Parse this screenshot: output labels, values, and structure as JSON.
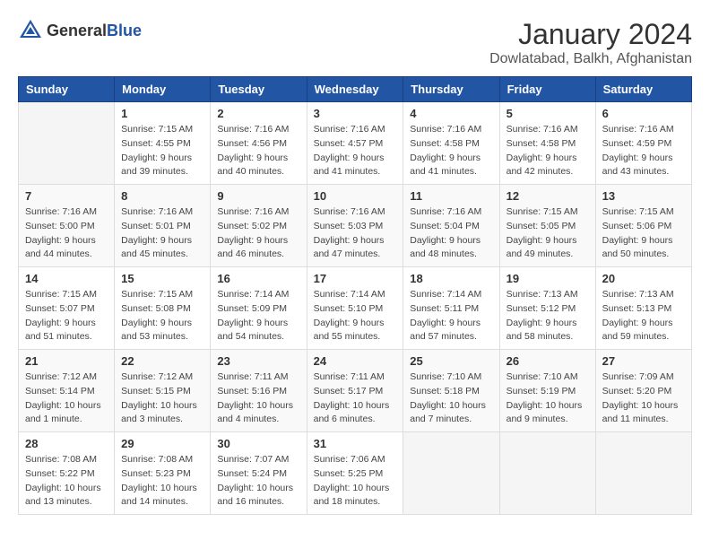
{
  "header": {
    "logo_general": "General",
    "logo_blue": "Blue",
    "title": "January 2024",
    "location": "Dowlatabad, Balkh, Afghanistan"
  },
  "weekdays": [
    "Sunday",
    "Monday",
    "Tuesday",
    "Wednesday",
    "Thursday",
    "Friday",
    "Saturday"
  ],
  "weeks": [
    [
      {
        "day": "",
        "info": ""
      },
      {
        "day": "1",
        "info": "Sunrise: 7:15 AM\nSunset: 4:55 PM\nDaylight: 9 hours\nand 39 minutes."
      },
      {
        "day": "2",
        "info": "Sunrise: 7:16 AM\nSunset: 4:56 PM\nDaylight: 9 hours\nand 40 minutes."
      },
      {
        "day": "3",
        "info": "Sunrise: 7:16 AM\nSunset: 4:57 PM\nDaylight: 9 hours\nand 41 minutes."
      },
      {
        "day": "4",
        "info": "Sunrise: 7:16 AM\nSunset: 4:58 PM\nDaylight: 9 hours\nand 41 minutes."
      },
      {
        "day": "5",
        "info": "Sunrise: 7:16 AM\nSunset: 4:58 PM\nDaylight: 9 hours\nand 42 minutes."
      },
      {
        "day": "6",
        "info": "Sunrise: 7:16 AM\nSunset: 4:59 PM\nDaylight: 9 hours\nand 43 minutes."
      }
    ],
    [
      {
        "day": "7",
        "info": "Sunrise: 7:16 AM\nSunset: 5:00 PM\nDaylight: 9 hours\nand 44 minutes."
      },
      {
        "day": "8",
        "info": "Sunrise: 7:16 AM\nSunset: 5:01 PM\nDaylight: 9 hours\nand 45 minutes."
      },
      {
        "day": "9",
        "info": "Sunrise: 7:16 AM\nSunset: 5:02 PM\nDaylight: 9 hours\nand 46 minutes."
      },
      {
        "day": "10",
        "info": "Sunrise: 7:16 AM\nSunset: 5:03 PM\nDaylight: 9 hours\nand 47 minutes."
      },
      {
        "day": "11",
        "info": "Sunrise: 7:16 AM\nSunset: 5:04 PM\nDaylight: 9 hours\nand 48 minutes."
      },
      {
        "day": "12",
        "info": "Sunrise: 7:15 AM\nSunset: 5:05 PM\nDaylight: 9 hours\nand 49 minutes."
      },
      {
        "day": "13",
        "info": "Sunrise: 7:15 AM\nSunset: 5:06 PM\nDaylight: 9 hours\nand 50 minutes."
      }
    ],
    [
      {
        "day": "14",
        "info": "Sunrise: 7:15 AM\nSunset: 5:07 PM\nDaylight: 9 hours\nand 51 minutes."
      },
      {
        "day": "15",
        "info": "Sunrise: 7:15 AM\nSunset: 5:08 PM\nDaylight: 9 hours\nand 53 minutes."
      },
      {
        "day": "16",
        "info": "Sunrise: 7:14 AM\nSunset: 5:09 PM\nDaylight: 9 hours\nand 54 minutes."
      },
      {
        "day": "17",
        "info": "Sunrise: 7:14 AM\nSunset: 5:10 PM\nDaylight: 9 hours\nand 55 minutes."
      },
      {
        "day": "18",
        "info": "Sunrise: 7:14 AM\nSunset: 5:11 PM\nDaylight: 9 hours\nand 57 minutes."
      },
      {
        "day": "19",
        "info": "Sunrise: 7:13 AM\nSunset: 5:12 PM\nDaylight: 9 hours\nand 58 minutes."
      },
      {
        "day": "20",
        "info": "Sunrise: 7:13 AM\nSunset: 5:13 PM\nDaylight: 9 hours\nand 59 minutes."
      }
    ],
    [
      {
        "day": "21",
        "info": "Sunrise: 7:12 AM\nSunset: 5:14 PM\nDaylight: 10 hours\nand 1 minute."
      },
      {
        "day": "22",
        "info": "Sunrise: 7:12 AM\nSunset: 5:15 PM\nDaylight: 10 hours\nand 3 minutes."
      },
      {
        "day": "23",
        "info": "Sunrise: 7:11 AM\nSunset: 5:16 PM\nDaylight: 10 hours\nand 4 minutes."
      },
      {
        "day": "24",
        "info": "Sunrise: 7:11 AM\nSunset: 5:17 PM\nDaylight: 10 hours\nand 6 minutes."
      },
      {
        "day": "25",
        "info": "Sunrise: 7:10 AM\nSunset: 5:18 PM\nDaylight: 10 hours\nand 7 minutes."
      },
      {
        "day": "26",
        "info": "Sunrise: 7:10 AM\nSunset: 5:19 PM\nDaylight: 10 hours\nand 9 minutes."
      },
      {
        "day": "27",
        "info": "Sunrise: 7:09 AM\nSunset: 5:20 PM\nDaylight: 10 hours\nand 11 minutes."
      }
    ],
    [
      {
        "day": "28",
        "info": "Sunrise: 7:08 AM\nSunset: 5:22 PM\nDaylight: 10 hours\nand 13 minutes."
      },
      {
        "day": "29",
        "info": "Sunrise: 7:08 AM\nSunset: 5:23 PM\nDaylight: 10 hours\nand 14 minutes."
      },
      {
        "day": "30",
        "info": "Sunrise: 7:07 AM\nSunset: 5:24 PM\nDaylight: 10 hours\nand 16 minutes."
      },
      {
        "day": "31",
        "info": "Sunrise: 7:06 AM\nSunset: 5:25 PM\nDaylight: 10 hours\nand 18 minutes."
      },
      {
        "day": "",
        "info": ""
      },
      {
        "day": "",
        "info": ""
      },
      {
        "day": "",
        "info": ""
      }
    ]
  ]
}
